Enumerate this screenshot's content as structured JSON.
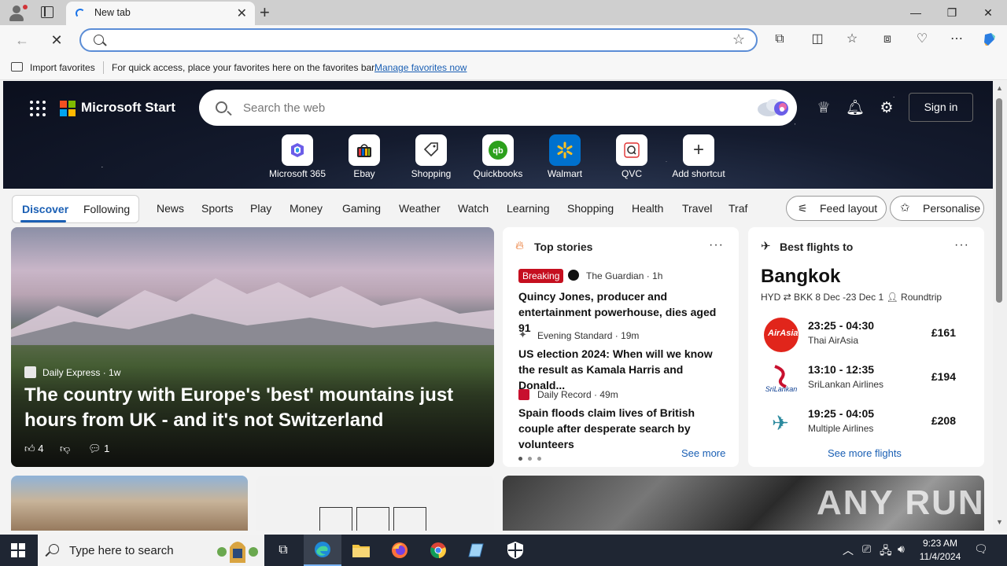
{
  "browser": {
    "tab_title": "New tab",
    "favorites_bar": {
      "import_label": "Import favorites",
      "message": "For quick access, place your favorites here on the favorites bar.",
      "manage_link": "Manage favorites now"
    }
  },
  "header": {
    "brand": "Microsoft Start",
    "search_placeholder": "Search the web",
    "sign_in": "Sign in"
  },
  "shortcuts": [
    {
      "label": "Microsoft 365",
      "icon": "m365-icon"
    },
    {
      "label": "Ebay",
      "icon": "ebay-icon"
    },
    {
      "label": "Shopping",
      "icon": "shopping-tag-icon"
    },
    {
      "label": "Quickbooks",
      "icon": "quickbooks-icon"
    },
    {
      "label": "Walmart",
      "icon": "walmart-icon"
    },
    {
      "label": "QVC",
      "icon": "qvc-icon"
    },
    {
      "label": "Add shortcut",
      "icon": "plus-icon"
    }
  ],
  "feed_nav": {
    "discover": "Discover",
    "following": "Following",
    "categories": [
      "News",
      "Sports",
      "Play",
      "Money",
      "Gaming",
      "Weather",
      "Watch",
      "Learning",
      "Shopping",
      "Health",
      "Travel",
      "Traf"
    ],
    "feed_layout": "Feed layout",
    "personalise": "Personalise"
  },
  "hero": {
    "source": "Daily Express",
    "age": "· 1w",
    "headline": "The country with Europe's 'best' mountains just hours from UK - and it's not Switzerland",
    "likes": "4",
    "comments": "1"
  },
  "top_stories": {
    "title": "Top stories",
    "breaking": "Breaking",
    "stories": [
      {
        "source": "The Guardian · 1h",
        "headline": "Quincy Jones, producer and entertainment powerhouse, dies aged 91"
      },
      {
        "source": "Evening Standard · 19m",
        "headline": "US election 2024: When will we know the result as Kamala Harris and Donald..."
      },
      {
        "source": "Daily Record · 49m",
        "headline": "Spain floods claim lives of British couple after desperate search by volunteers"
      }
    ],
    "see_more": "See more"
  },
  "flights": {
    "title": "Best flights to",
    "city": "Bangkok",
    "route": "HYD ⇄ BKK  8 Dec -23 Dec  1",
    "trip": "Roundtrip",
    "items": [
      {
        "time": "23:25 - 04:30",
        "airline": "Thai AirAsia",
        "price": "£161"
      },
      {
        "time": "13:10 - 12:35",
        "airline": "SriLankan Airlines",
        "price": "£194"
      },
      {
        "time": "19:25 - 04:05",
        "airline": "Multiple Airlines",
        "price": "£208"
      }
    ],
    "see_more": "See more flights"
  },
  "watermark": "ANY RUN",
  "taskbar": {
    "search_placeholder": "Type here to search",
    "time": "9:23 AM",
    "date": "11/4/2024"
  },
  "colors": {
    "accent": "#1a5fb4",
    "breaking": "#c50f1f",
    "taskbar": "#1f2633"
  }
}
